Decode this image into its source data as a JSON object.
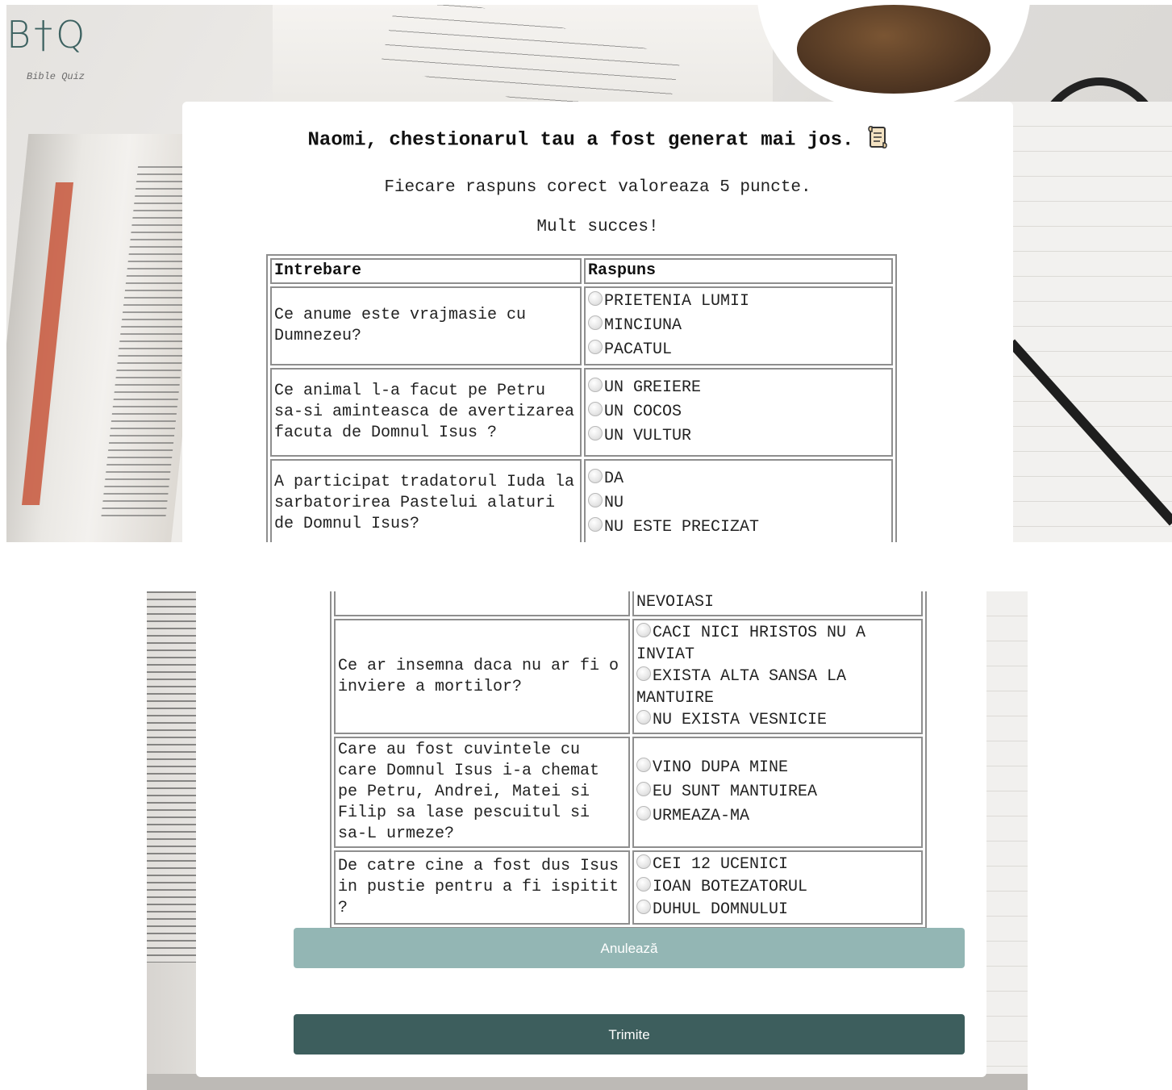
{
  "brand": {
    "logo_mark": "B†Q",
    "logo_subtitle": "Bible Quiz"
  },
  "header": {
    "title": "Naomi, chestionarul tau a fost generat mai jos.",
    "title_icon": "scroll-icon",
    "points_text": "Fiecare raspuns corect valoreaza 5 puncte.",
    "good_luck_text": "Mult succes!"
  },
  "table": {
    "col_question": "Intrebare",
    "col_answer": "Raspuns"
  },
  "questions_top": [
    {
      "question": "Ce anume este vrajmasie cu Dumnezeu?",
      "options": [
        "PRIETENIA LUMII",
        "MINCIUNA",
        "PACATUL"
      ]
    },
    {
      "question": "Ce animal l-a facut pe Petru sa-si aminteasca de avertizarea facuta de Domnul Isus ?",
      "options": [
        "UN GREIERE",
        "UN COCOS",
        "UN VULTUR"
      ]
    },
    {
      "question": "A participat tradatorul Iuda la sarbatorirea Pastelui alaturi de Domnul Isus?",
      "options": [
        "DA",
        "NU",
        "NU ESTE PRECIZAT"
      ]
    }
  ],
  "questions_bottom": {
    "cut_off_text": "NEVOIASI",
    "rows": [
      {
        "question": "Ce ar insemna daca nu ar fi o inviere a mortilor?",
        "options": [
          "CACI NICI HRISTOS NU A INVIAT",
          "EXISTA ALTA SANSA LA MANTUIRE",
          "NU EXISTA VESNICIE"
        ]
      },
      {
        "question": "Care au fost cuvintele cu care Domnul Isus i-a chemat pe Petru, Andrei, Matei si Filip sa lase pescuitul si sa-L urmeze?",
        "options": [
          "VINO DUPA MINE",
          "EU SUNT MANTUIREA",
          "URMEAZA-MA"
        ]
      },
      {
        "question": "De catre cine a fost dus Isus in pustie pentru a fi ispitit ?",
        "options": [
          "CEI 12 UCENICI",
          "IOAN BOTEZATORUL",
          "DUHUL DOMNULUI"
        ]
      }
    ]
  },
  "buttons": {
    "cancel_label": "Anulează",
    "submit_label": "Trimite"
  },
  "colors": {
    "brand_dark": "#3d5e5d",
    "brand_light": "#93b6b4"
  }
}
